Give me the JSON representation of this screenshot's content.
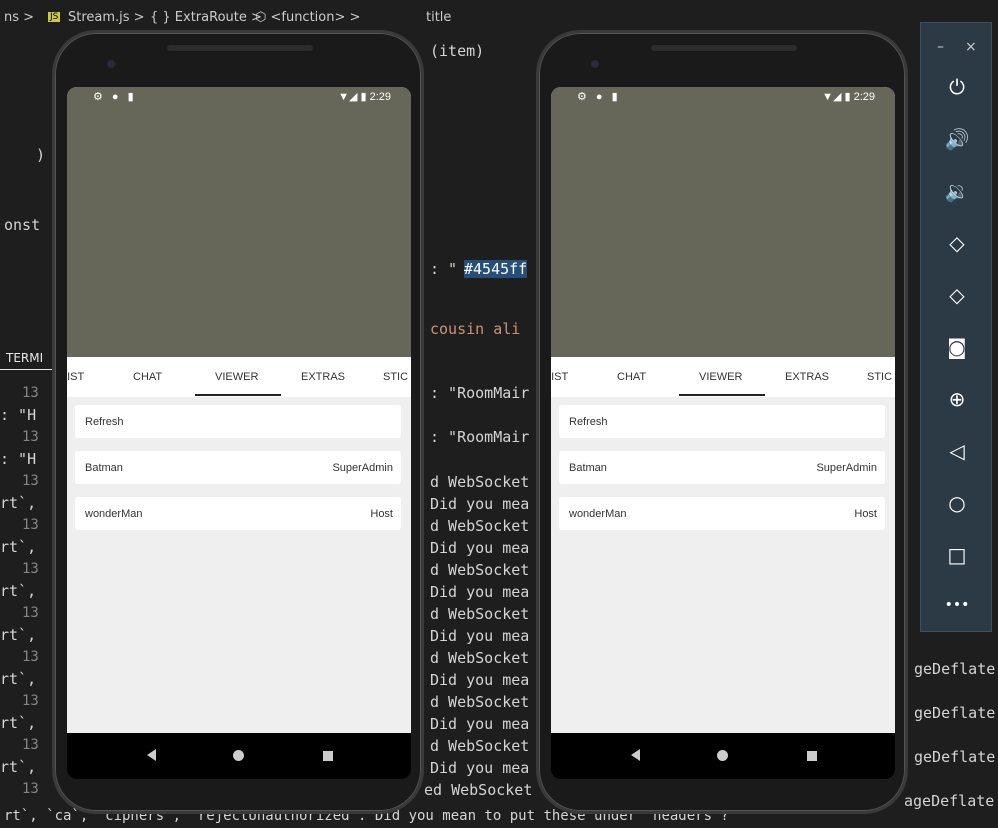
{
  "editor": {
    "breadcrumb": [
      "ns >",
      "JS",
      "Stream.js >",
      "{ } ExtraRoute >",
      "⬡ <function> >",
      "title"
    ],
    "code_top": "(item)",
    "code_const": "onst",
    "code_paren": ")",
    "code_color_prefix": ": \"",
    "code_color_selected": "#4545ff",
    "code_cousin": "cousin ali",
    "terminal_tab": "TERMI",
    "line_numbers": [
      "13",
      "13",
      "13",
      "13",
      "13",
      "13",
      "13",
      "13",
      "13",
      "13"
    ],
    "left_fragments": [
      ": \"H",
      ": \"H",
      "rt`,",
      "rt`,",
      "rt`,",
      "rt`,",
      "rt`,",
      "rt`,",
      "rt`,"
    ],
    "mid_lines": [
      ": \"RoomMair",
      ": \"RoomMair",
      "d WebSocket",
      "Did you mea",
      "d WebSocket",
      "Did you mea",
      "d WebSocket",
      "Did you mea",
      "d WebSocket",
      "Did you mea",
      "d WebSocket",
      "Did you mea",
      "d WebSocket",
      "Did you mea",
      "d WebSocket",
      "Did you mea",
      "ed WebSocket"
    ],
    "right_fragments": [
      "geDeflate",
      "geDeflate",
      "geDeflate",
      "ageDeflate"
    ],
    "bottom_line": "rt`, `ca`, `ciphers`, `rejectUnauthorized`. Did you mean to put these under `headers`?"
  },
  "phones": [
    {
      "status": {
        "left_icons": "⚙ ● ▮",
        "right": "▼◢ ▮ 2:29"
      },
      "tabs": [
        "LIST",
        "CHAT",
        "VIEWER",
        "EXTRAS",
        "STIC"
      ],
      "active_tab": "VIEWER",
      "rows": [
        {
          "name": "Refresh",
          "role": ""
        },
        {
          "name": "Batman",
          "role": "SuperAdmin"
        },
        {
          "name": "wonderMan",
          "role": "Host"
        }
      ]
    },
    {
      "status": {
        "left_icons": "⚙ ● ▮",
        "right": "▼◢ ▮ 2:29"
      },
      "tabs": [
        "LIST",
        "CHAT",
        "VIEWER",
        "EXTRAS",
        "STIC"
      ],
      "active_tab": "VIEWER",
      "rows": [
        {
          "name": "Refresh",
          "role": ""
        },
        {
          "name": "Batman",
          "role": "SuperAdmin"
        },
        {
          "name": "wonderMan",
          "role": "Host"
        }
      ]
    }
  ],
  "toolbar": {
    "minimize": "–",
    "close": "×",
    "buttons": [
      {
        "icon": "power-icon",
        "glyph": "⏻"
      },
      {
        "icon": "volume-up-icon",
        "glyph": "🔊"
      },
      {
        "icon": "volume-down-icon",
        "glyph": "🔉"
      },
      {
        "icon": "rotate-left-icon",
        "glyph": "◇"
      },
      {
        "icon": "rotate-right-icon",
        "glyph": "◇"
      },
      {
        "icon": "camera-icon",
        "glyph": "◙"
      },
      {
        "icon": "zoom-icon",
        "glyph": "⊕"
      },
      {
        "icon": "back-icon",
        "glyph": "◁"
      },
      {
        "icon": "home-icon",
        "glyph": "○"
      },
      {
        "icon": "overview-icon",
        "glyph": "□"
      },
      {
        "icon": "more-icon",
        "glyph": "•••"
      }
    ]
  },
  "colors": {
    "video": "#666758",
    "editor_bg": "#1e1e1e",
    "toolbar_bg": "#2b3a45"
  }
}
